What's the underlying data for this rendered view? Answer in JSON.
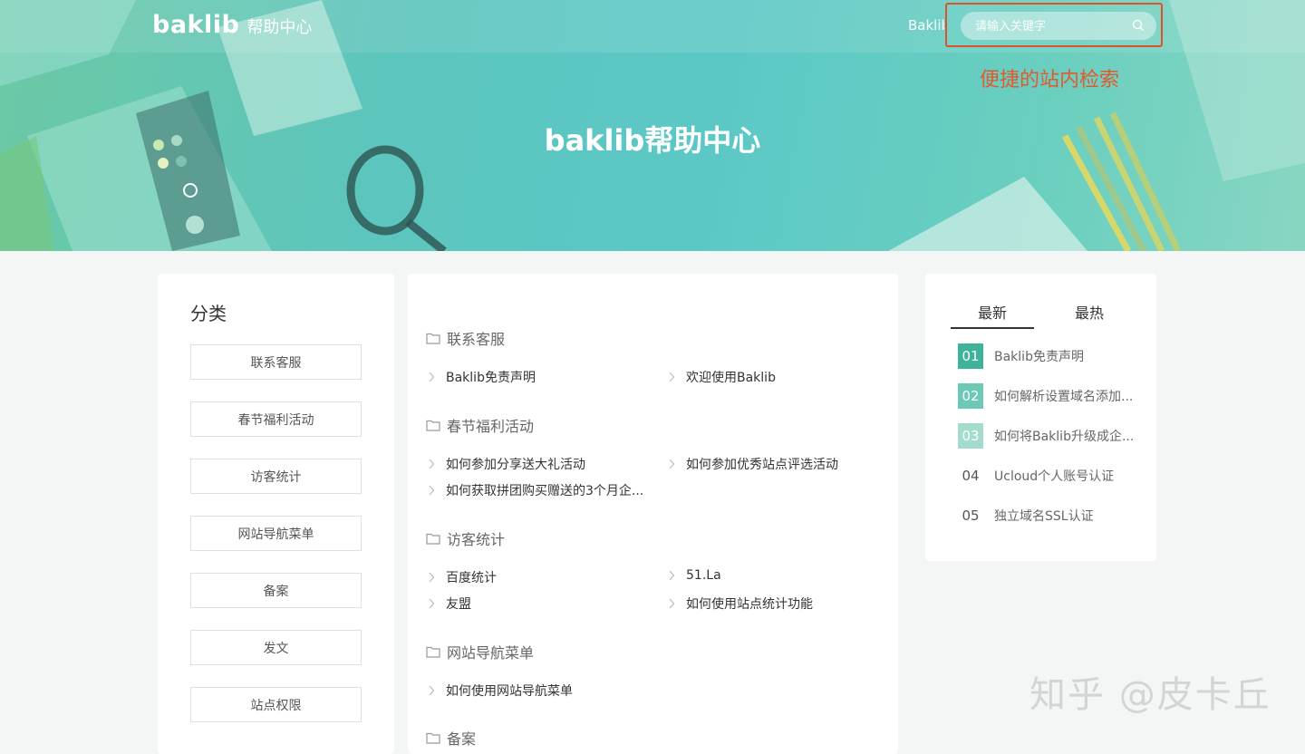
{
  "header": {
    "logo_text": "baklib",
    "logo_sub": "帮助中心",
    "nav_link": "Baklib",
    "search_placeholder": "请输入关键字"
  },
  "annotation": {
    "text": "便捷的站内检索"
  },
  "hero": {
    "title": "baklib帮助中心"
  },
  "categories": {
    "title": "分类",
    "items": [
      "联系客服",
      "春节福利活动",
      "访客统计",
      "网站导航菜单",
      "备案",
      "发文",
      "站点权限"
    ]
  },
  "sections": [
    {
      "title": "联系客服",
      "articles": [
        "Baklib免责声明",
        "欢迎使用Baklib"
      ]
    },
    {
      "title": "春节福利活动",
      "articles": [
        "如何参加分享送大礼活动",
        "如何参加优秀站点评选活动",
        "如何获取拼团购买赠送的3个月企..."
      ]
    },
    {
      "title": "访客统计",
      "articles": [
        "百度统计",
        "51.La",
        "友盟",
        "如何使用站点统计功能"
      ]
    },
    {
      "title": "网站导航菜单",
      "articles": [
        "如何使用网站导航菜单"
      ]
    },
    {
      "title": "备案",
      "articles": []
    }
  ],
  "ranking": {
    "tabs": [
      "最新",
      "最热"
    ],
    "active_tab": "最新",
    "items": [
      {
        "num": "01",
        "title": "Baklib免责声明"
      },
      {
        "num": "02",
        "title": "如何解析设置域名添加..."
      },
      {
        "num": "03",
        "title": "如何将Baklib升级成企..."
      },
      {
        "num": "04",
        "title": "Ucloud个人账号认证"
      },
      {
        "num": "05",
        "title": "独立域名SSL认证"
      }
    ],
    "badge_colors": [
      "#3db39a",
      "#6cc9b6",
      "#a3dccf"
    ]
  },
  "watermark": "知乎 @皮卡丘"
}
